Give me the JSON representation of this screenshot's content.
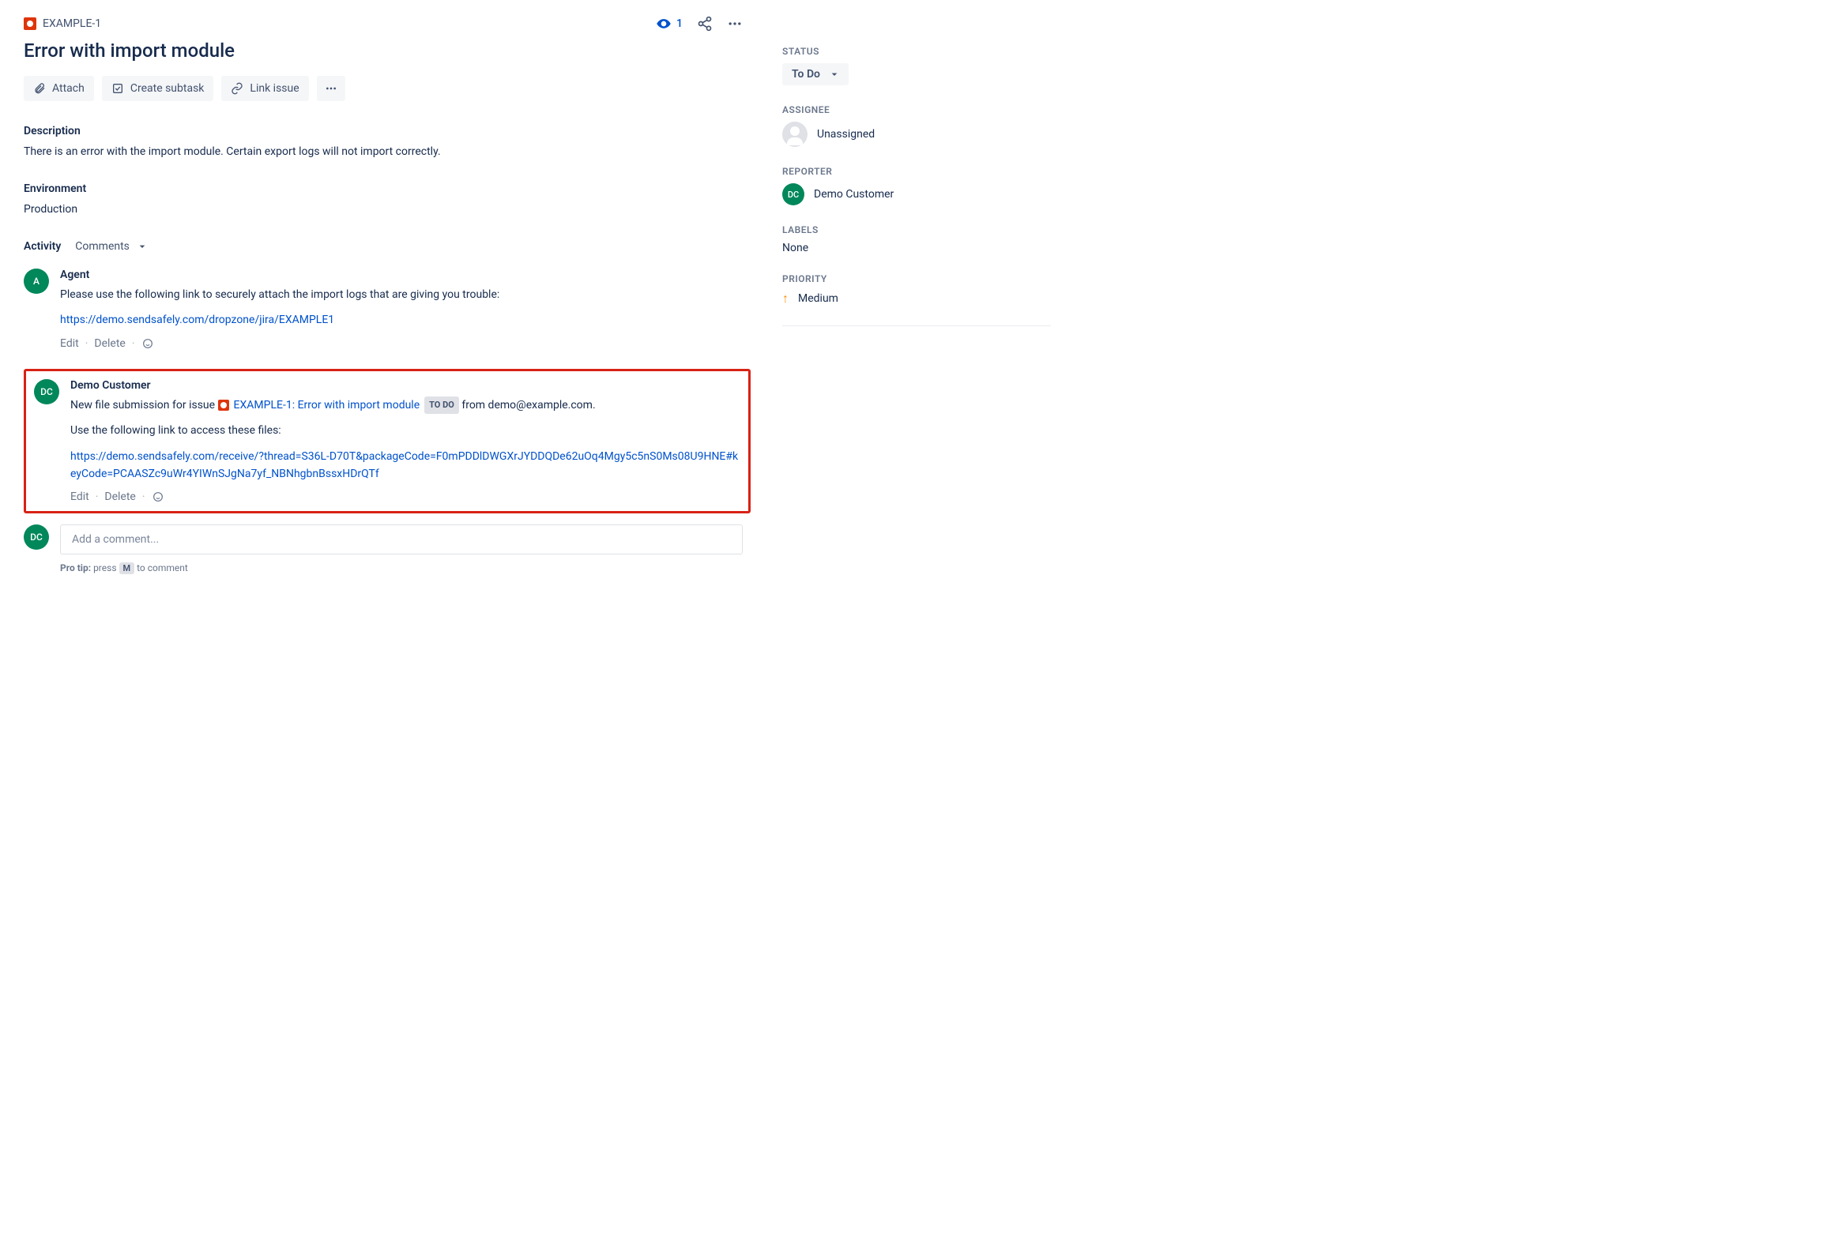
{
  "breadcrumb": {
    "key": "EXAMPLE-1"
  },
  "watch": {
    "count": "1"
  },
  "title": "Error with import module",
  "actions": {
    "attach": "Attach",
    "subtask": "Create subtask",
    "link": "Link issue"
  },
  "description": {
    "label": "Description",
    "text": "There is an error with the import module. Certain export logs will not import correctly."
  },
  "environment": {
    "label": "Environment",
    "text": "Production"
  },
  "activity": {
    "label": "Activity",
    "filter": "Comments"
  },
  "comments": [
    {
      "avatar_initials": "A",
      "author": "Agent",
      "body_text": "Please use the following link to securely attach the import logs that are giving you trouble:",
      "link": "https://demo.sendsafely.com/dropzone/jira/EXAMPLE1",
      "edit": "Edit",
      "delete": "Delete"
    },
    {
      "avatar_initials": "DC",
      "author": "Demo Customer",
      "pre_text": "New file submission for issue",
      "issue_ref": "EXAMPLE-1: Error with import module",
      "status_badge": "TO DO",
      "post_text": "from demo@example.com.",
      "line2": "Use the following link to access these files:",
      "link": "https://demo.sendsafely.com/receive/?thread=S36L-D70T&packageCode=F0mPDDlDWGXrJYDDQDe62uOq4Mgy5c5nS0Ms08U9HNE#keyCode=PCAASZc9uWr4YIWnSJgNa7yf_NBNhgbnBssxHDrQTf",
      "edit": "Edit",
      "delete": "Delete"
    }
  ],
  "add_comment": {
    "avatar_initials": "DC",
    "placeholder": "Add a comment...",
    "tip_bold": "Pro tip:",
    "tip_pre": "press",
    "tip_key": "M",
    "tip_post": "to comment"
  },
  "sidebar": {
    "status": {
      "label": "STATUS",
      "value": "To Do"
    },
    "assignee": {
      "label": "ASSIGNEE",
      "value": "Unassigned"
    },
    "reporter": {
      "label": "REPORTER",
      "value": "Demo Customer",
      "initials": "DC"
    },
    "labels": {
      "label": "LABELS",
      "value": "None"
    },
    "priority": {
      "label": "PRIORITY",
      "value": "Medium"
    }
  }
}
